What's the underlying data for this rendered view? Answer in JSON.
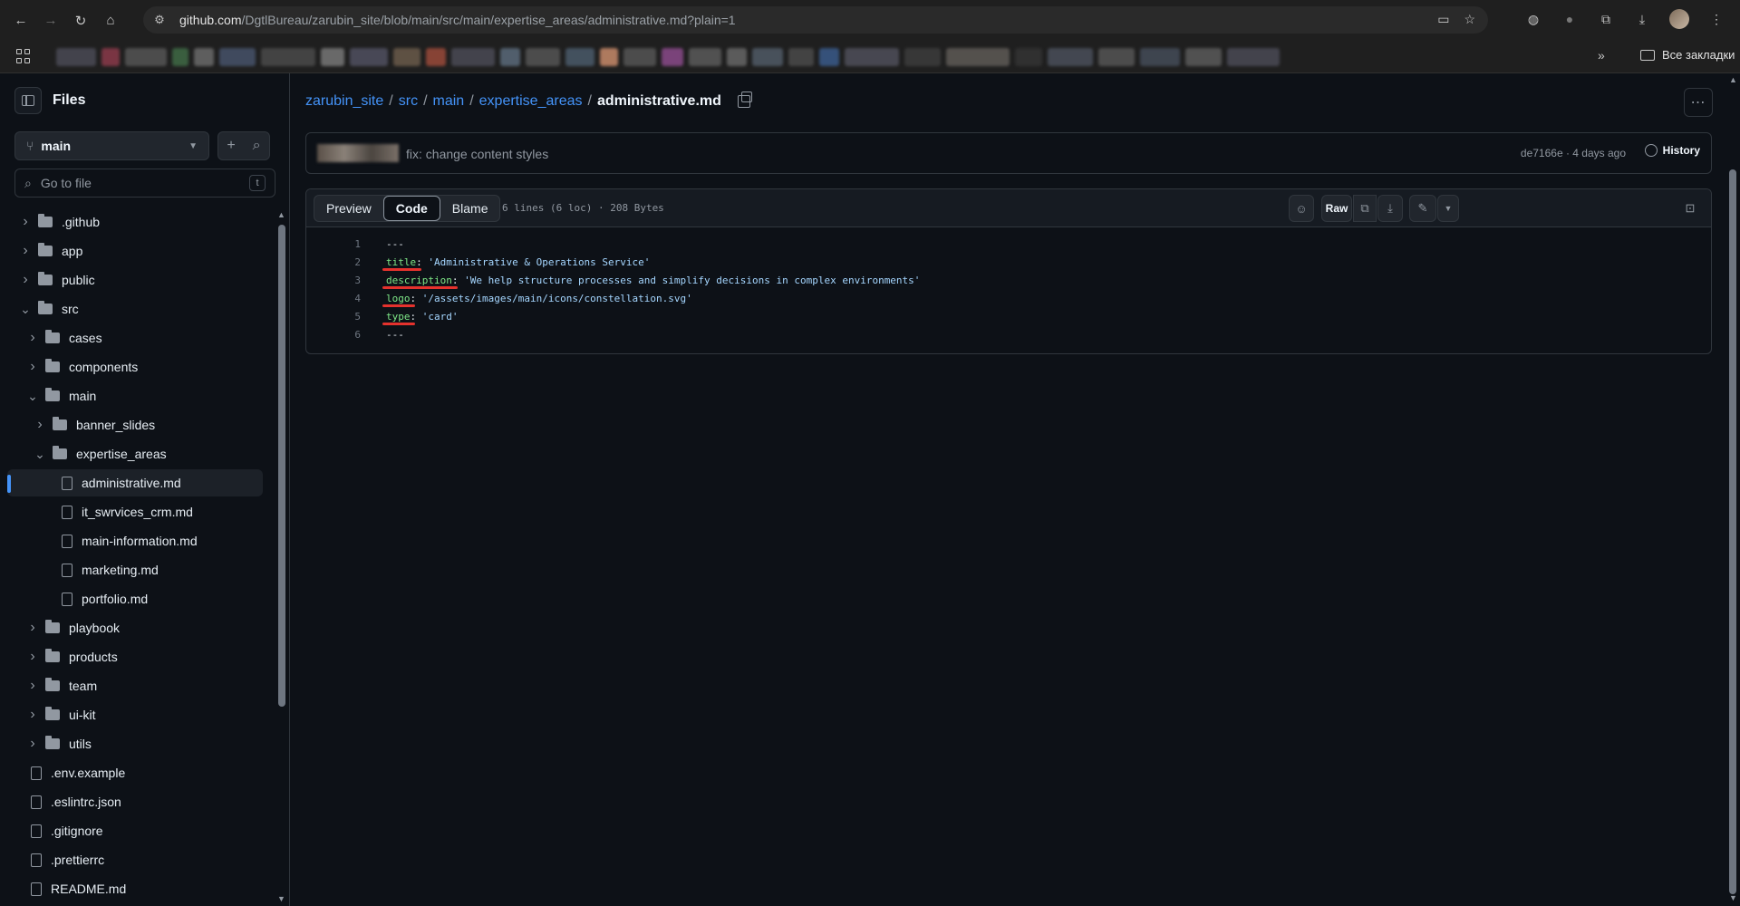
{
  "browser": {
    "url_host": "github.com",
    "url_path": "/DgtlBureau/zarubin_site/blob/main/src/main/expertise_areas/administrative.md?plain=1",
    "all_bookmarks": "Все закладки"
  },
  "sidebar": {
    "title": "Files",
    "branch": "main",
    "goto_placeholder": "Go to file",
    "goto_shortcut": "t",
    "tree": [
      {
        "label": ".github",
        "type": "folder",
        "depth": 0,
        "expanded": false
      },
      {
        "label": "app",
        "type": "folder",
        "depth": 0,
        "expanded": false
      },
      {
        "label": "public",
        "type": "folder",
        "depth": 0,
        "expanded": false
      },
      {
        "label": "src",
        "type": "folder",
        "depth": 0,
        "expanded": true
      },
      {
        "label": "cases",
        "type": "folder",
        "depth": 1,
        "expanded": false
      },
      {
        "label": "components",
        "type": "folder",
        "depth": 1,
        "expanded": false
      },
      {
        "label": "main",
        "type": "folder",
        "depth": 1,
        "expanded": true
      },
      {
        "label": "banner_slides",
        "type": "folder",
        "depth": 2,
        "expanded": false
      },
      {
        "label": "expertise_areas",
        "type": "folder",
        "depth": 2,
        "expanded": true
      },
      {
        "label": "administrative.md",
        "type": "file",
        "depth": 3,
        "active": true
      },
      {
        "label": "it_swrvices_crm.md",
        "type": "file",
        "depth": 3
      },
      {
        "label": "main-information.md",
        "type": "file",
        "depth": 3
      },
      {
        "label": "marketing.md",
        "type": "file",
        "depth": 3
      },
      {
        "label": "portfolio.md",
        "type": "file",
        "depth": 3
      },
      {
        "label": "playbook",
        "type": "folder",
        "depth": 1,
        "expanded": false
      },
      {
        "label": "products",
        "type": "folder",
        "depth": 1,
        "expanded": false
      },
      {
        "label": "team",
        "type": "folder",
        "depth": 1,
        "expanded": false
      },
      {
        "label": "ui-kit",
        "type": "folder",
        "depth": 1,
        "expanded": false
      },
      {
        "label": "utils",
        "type": "folder",
        "depth": 1,
        "expanded": false
      },
      {
        "label": ".env.example",
        "type": "file",
        "depth": 0
      },
      {
        "label": ".eslintrc.json",
        "type": "file",
        "depth": 0
      },
      {
        "label": ".gitignore",
        "type": "file",
        "depth": 0
      },
      {
        "label": ".prettierrc",
        "type": "file",
        "depth": 0
      },
      {
        "label": "README.md",
        "type": "file",
        "depth": 0
      }
    ]
  },
  "breadcrumb": {
    "repo": "zarubin_site",
    "parts": [
      "src",
      "main",
      "expertise_areas"
    ],
    "sep": "/",
    "file": "administrative.md"
  },
  "commit": {
    "message": "fix: change content styles",
    "meta": "de7166e · 4 days ago",
    "history_label": "History"
  },
  "viewer": {
    "tabs": [
      "Preview",
      "Code",
      "Blame"
    ],
    "active_tab": "Code",
    "stats": "6 lines (6 loc) · 208 Bytes",
    "raw_label": "Raw"
  },
  "code": [
    {
      "n": "1",
      "raw": "---"
    },
    {
      "n": "2",
      "key": "title",
      "value": "'Administrative & Operations Service'"
    },
    {
      "n": "3",
      "key": "description",
      "value": "'We help structure processes and simplify decisions in complex environments'"
    },
    {
      "n": "4",
      "key": "logo",
      "value": "'/assets/images/main/icons/constellation.svg'"
    },
    {
      "n": "5",
      "key": "type",
      "value": "'card'"
    },
    {
      "n": "6",
      "raw": "---"
    }
  ],
  "colors": {
    "accent_link": "#4493f8",
    "yaml_key": "#7ee787",
    "yaml_string": "#a5d6ff",
    "annotation_underline": "#e5322d"
  }
}
